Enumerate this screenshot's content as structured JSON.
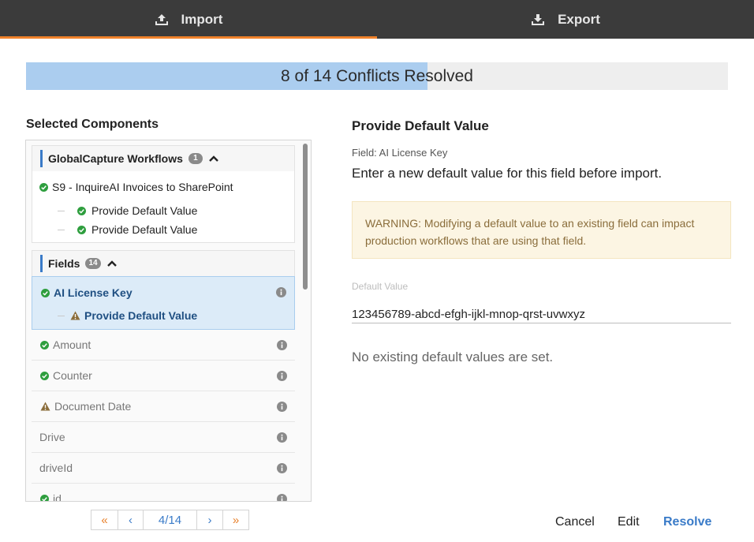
{
  "tabs": [
    {
      "label": "Import",
      "icon": "upload-icon",
      "active": true
    },
    {
      "label": "Export",
      "icon": "download-icon",
      "active": false
    }
  ],
  "progress": {
    "text": "8 of 14 Conflicts Resolved",
    "resolved": 8,
    "total": 14
  },
  "left": {
    "title": "Selected Components",
    "groups": {
      "workflows": {
        "label": "GlobalCapture Workflows",
        "count": "1",
        "item": "S9 - InquireAI Invoices to SharePoint",
        "subitems": [
          "Provide Default Value",
          "Provide Default Value"
        ]
      },
      "fields": {
        "label": "Fields",
        "count": "14"
      }
    },
    "fields": [
      {
        "label": "AI License Key",
        "status": "resolved",
        "selected": true,
        "subitem": "Provide Default Value",
        "substatus": "warning"
      },
      {
        "label": "Amount",
        "status": "resolved"
      },
      {
        "label": "Counter",
        "status": "resolved"
      },
      {
        "label": "Document Date",
        "status": "warning"
      },
      {
        "label": "Drive",
        "status": "none"
      },
      {
        "label": "driveId",
        "status": "none"
      },
      {
        "label": "id",
        "status": "resolved"
      }
    ]
  },
  "pager": {
    "first": "«",
    "prev": "‹",
    "page": "4/14",
    "next": "›",
    "last": "»"
  },
  "right": {
    "title": "Provide Default Value",
    "field": "Field: AI License Key",
    "description": "Enter a new default value for this field before import.",
    "warning": "WARNING: Modifying a default value to an existing field can impact production workflows that are using that field.",
    "default_label": "Default Value",
    "default_value": "123456789-abcd-efgh-ijkl-mnop-qrst-uvwxyz",
    "no_existing": "No existing default values are set."
  },
  "actions": {
    "cancel": "Cancel",
    "edit": "Edit",
    "resolve": "Resolve"
  },
  "colors": {
    "accent": "#f0822b",
    "link": "#3a7bc8",
    "success": "#2e9e3e",
    "warning": "#8a6d3b",
    "progress_fill": "#abcdef"
  }
}
